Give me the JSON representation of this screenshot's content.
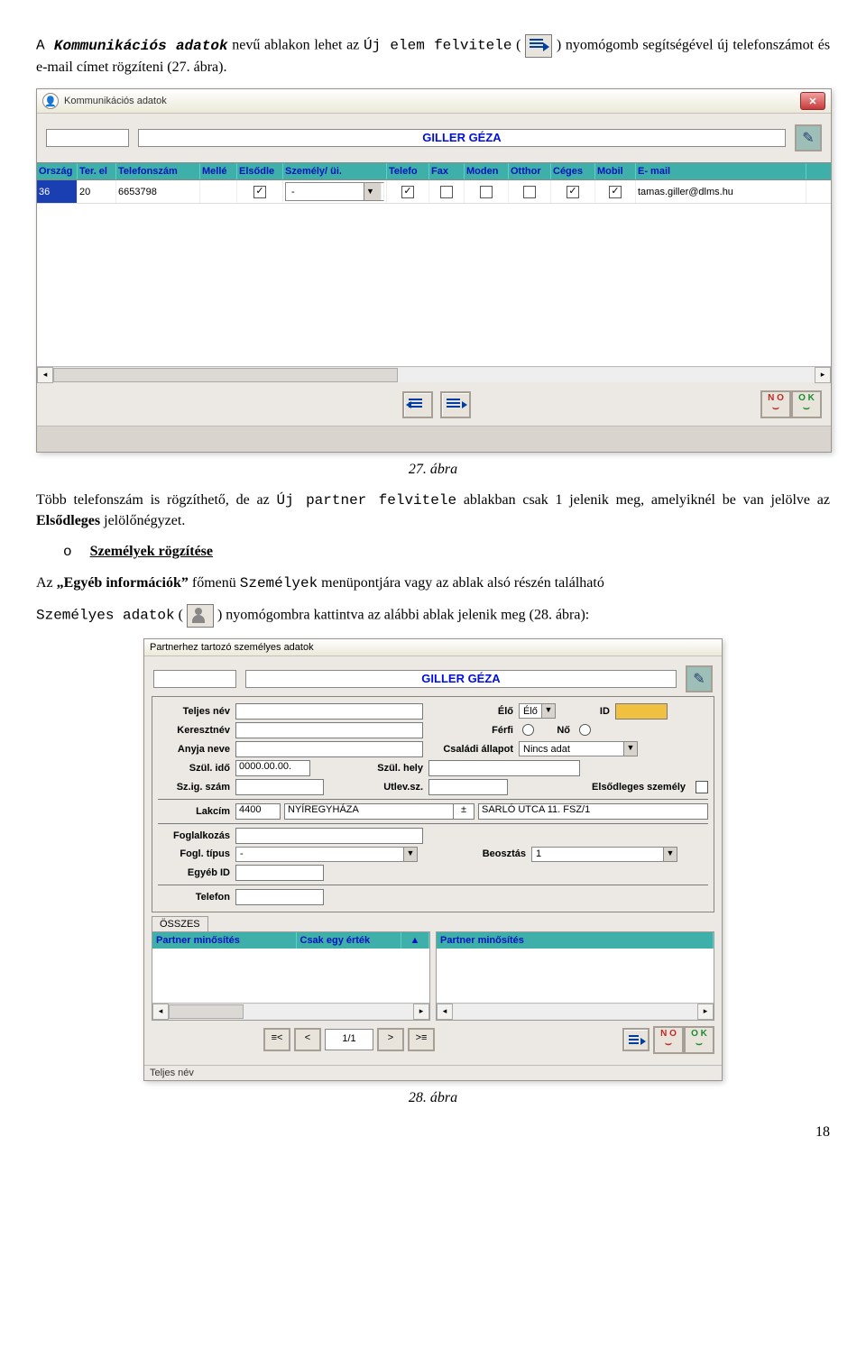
{
  "intro": {
    "prefix": "A ",
    "title": "Kommunikációs adatok",
    "mid": " nevű ablakon lehet az ",
    "em": "Új elem felvitele",
    "open": " (",
    "close": ") nyomógomb segítségével új telefonszámot és e-mail címet rögzíteni (27. ábra)."
  },
  "win1": {
    "title": "Kommunikációs adatok",
    "name": "GILLER GÉZA",
    "cols": [
      "Ország",
      "Ter. el",
      "Telefonszám",
      "Mellé",
      "Elsődle",
      "Személy/ üi.",
      "Telefo",
      "Fax",
      "Moden",
      "Otthor",
      "Céges",
      "Mobil",
      "E- mail"
    ],
    "widths": [
      40,
      38,
      88,
      36,
      46,
      110,
      42,
      34,
      44,
      42,
      44,
      40,
      184
    ],
    "row": {
      "orszag": "36",
      "ter": "20",
      "tel": "6653798",
      "mellek": "",
      "elsod": true,
      "szemely": "-",
      "telefon": true,
      "fax": false,
      "modem": false,
      "otthon": false,
      "ceges": true,
      "mobil": true,
      "email": "tamas.giller@dlms.hu"
    }
  },
  "caption1": "27. ábra",
  "mid": {
    "p1a": "Több telefonszám is rögzíthető, de az ",
    "p1b": "Új partner felvitele",
    "p1c": " ablakban csak 1 jelenik meg, amelyiknél be van jelölve az ",
    "p1d": "Elsődleges",
    "p1e": " jelölőnégyzet.",
    "bullet": "o",
    "heading": "Személyek rögzítése",
    "p2a": "Az ",
    "p2b": "„Egyéb információk”",
    "p2c": " főmenü ",
    "p2d": "Személyek",
    "p2e": " menüpontjára vagy az ablak alsó részén található",
    "p3a": "Személyes adatok",
    "p3b": " (",
    "p3c": ") nyomógombra kattintva az alábbi ablak jelenik meg (28. ábra):"
  },
  "win2": {
    "title": "Partnerhez tartozó személyes adatok",
    "name": "GILLER GÉZA",
    "labels": {
      "teljes": "Teljes név",
      "elo": "Élő",
      "eloval": "Élő",
      "id": "ID",
      "kereszt": "Keresztnév",
      "ferfi": "Férfi",
      "no": "Nő",
      "anyja": "Anyja neve",
      "csalad": "Családi állapot",
      "csaladval": "Nincs adat",
      "szulido": "Szül. idő",
      "szulidoval": "0000.00.00.",
      "szulhely": "Szül. hely",
      "szig": "Sz.ig. szám",
      "utlev": "Utlev.sz.",
      "elsod": "Elsődleges személy",
      "lakcim": "Lakcím",
      "zip": "4400",
      "city": "NYÍREGYHÁZA",
      "addr": "SARLÓ UTCA 11. FSZ/1",
      "fogl": "Foglalkozás",
      "fogltip": "Fogl. típus",
      "fogltipval": "-",
      "beoszt": "Beosztás",
      "beosztval": "1",
      "egyeb": "Egyéb ID",
      "telefon": "Telefon"
    },
    "tab": "ÖSSZES",
    "gridL": [
      "Partner minősítés",
      "Csak egy érték"
    ],
    "gridLbtn": "▲",
    "gridR": "Partner minősítés",
    "page": "1/1",
    "bottom": "Teljes név"
  },
  "caption2": "28. ábra",
  "pagenum": "18"
}
